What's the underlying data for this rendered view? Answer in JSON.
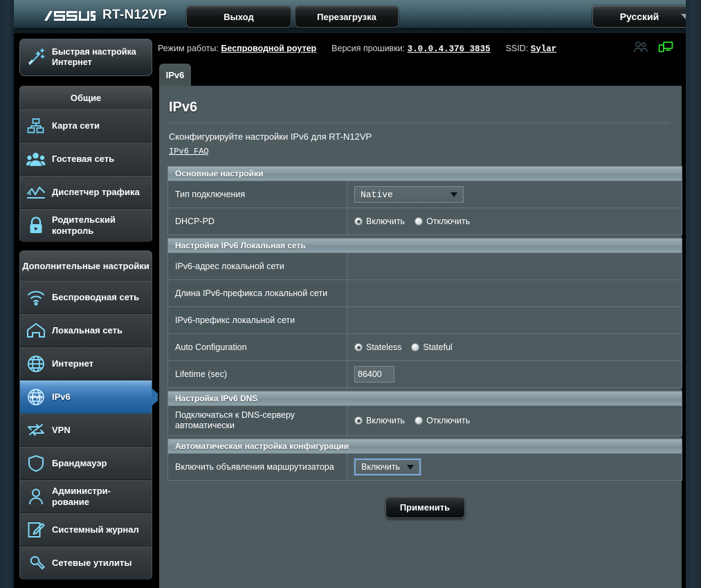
{
  "header": {
    "brand": "ASUS",
    "model": "RT-N12VP",
    "logout_label": "Выход",
    "reboot_label": "Перезагрузка",
    "language": "Русский",
    "accent_color": "#2f6ca8",
    "header_bg": "#3f5c68"
  },
  "status": {
    "mode_label": "Режим работы:",
    "mode_value": "Беспроводной  роутер",
    "firmware_label": "Версия прошивки:",
    "firmware_value": "3.0.0.4.376_3835",
    "ssid_label": "SSID:",
    "ssid_value": "Sylar",
    "icons": [
      "clients-icon",
      "usb-network-icon"
    ]
  },
  "sidebar": {
    "quick_setup": {
      "line1": "Быстрая настройка",
      "line2": "Интернет",
      "icon": "magic-wand-icon"
    },
    "groups": [
      {
        "title": "Общие",
        "items": [
          {
            "label": "Карта сети",
            "icon": "network-map-icon",
            "active": false
          },
          {
            "label": "Гостевая сеть",
            "icon": "guest-network-icon",
            "active": false
          },
          {
            "label": "Диспетчер трафика",
            "icon": "traffic-manager-icon",
            "active": false
          },
          {
            "label": "Родительский контроль",
            "icon": "parental-control-icon",
            "active": false
          }
        ]
      },
      {
        "title": "Дополнительные настройки",
        "items": [
          {
            "label": "Беспроводная сеть",
            "icon": "wifi-icon",
            "active": false
          },
          {
            "label": "Локальная сеть",
            "icon": "home-lan-icon",
            "active": false
          },
          {
            "label": "Интернет",
            "icon": "globe-icon",
            "active": false
          },
          {
            "label": "IPv6",
            "icon": "ipv6-icon",
            "active": true
          },
          {
            "label": "VPN",
            "icon": "vpn-icon",
            "active": false
          },
          {
            "label": "Брандмауэр",
            "icon": "shield-icon",
            "active": false
          },
          {
            "label": "Администри-рование",
            "icon": "administration-icon",
            "active": false
          },
          {
            "label": "Системный журнал",
            "icon": "system-log-icon",
            "active": false
          },
          {
            "label": "Сетевые утилиты",
            "icon": "network-tools-icon",
            "active": false
          }
        ]
      }
    ]
  },
  "main": {
    "tab_label": "IPv6",
    "page_title": "IPv6",
    "description": "Сконфигурируйте настройки IPv6 для RT-N12VP",
    "faq_link": "IPv6 FAQ",
    "sections": [
      {
        "title": "Основные настройки",
        "rows": [
          {
            "label": "Тип подключения",
            "control": "select",
            "value": "Native",
            "mono": true,
            "focused": false
          },
          {
            "label": "DHCP-PD",
            "control": "radio",
            "options": [
              {
                "label": "Включить",
                "selected": true
              },
              {
                "label": "Отключить",
                "selected": false
              }
            ]
          }
        ]
      },
      {
        "title": "Настройки IPv6 Локальная сеть",
        "rows": [
          {
            "label": "IPv6-адрес локальной сети",
            "control": "empty",
            "value": ""
          },
          {
            "label": "Длина IPv6-префикса локальной сети",
            "control": "empty",
            "value": ""
          },
          {
            "label": "IPv6-префикс локальной сети",
            "control": "empty",
            "value": ""
          },
          {
            "label": "Auto Configuration",
            "control": "radio",
            "options": [
              {
                "label": "Stateless",
                "selected": true
              },
              {
                "label": "Stateful",
                "selected": false
              }
            ]
          },
          {
            "label": "Lifetime (sec)",
            "control": "text",
            "value": "86400"
          }
        ]
      },
      {
        "title": "Настройка IPv6 DNS",
        "rows": [
          {
            "label": "Подключаться к DNS-серверу автоматически",
            "control": "radio",
            "options": [
              {
                "label": "Включить",
                "selected": true
              },
              {
                "label": "Отключить",
                "selected": false
              }
            ]
          }
        ]
      },
      {
        "title": "Автоматическая настройка конфигурации",
        "rows": [
          {
            "label": "Включить объявления маршрутизатора",
            "control": "select",
            "value": "Включить",
            "mono": false,
            "focused": true
          }
        ]
      }
    ],
    "apply_label": "Применить"
  }
}
